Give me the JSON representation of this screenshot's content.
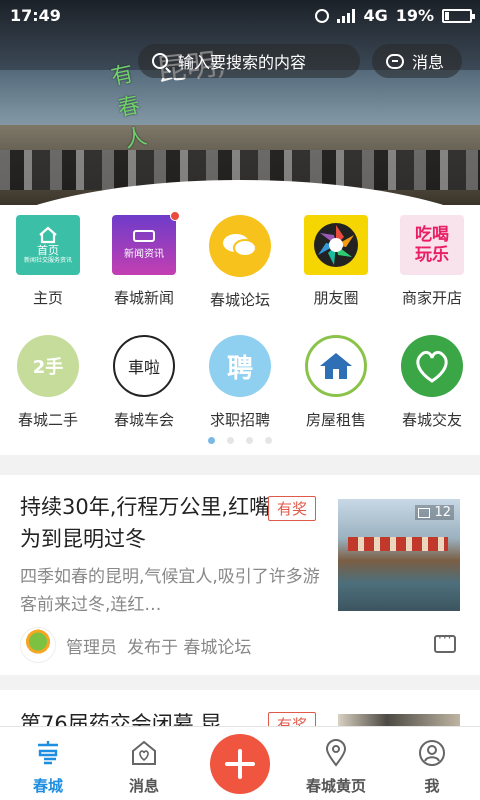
{
  "status": {
    "time": "17:49",
    "network": "4G",
    "battery": "19%"
  },
  "header": {
    "search_placeholder": "输入要搜索的内容",
    "messages_label": "消息",
    "banner_text_vertical": "有春人",
    "banner_text": "昆明,"
  },
  "grid": {
    "items": [
      {
        "label": "主页",
        "icon": "home-tile-icon",
        "tile_text": "首页",
        "tile_sub": "新闻社交服务资讯"
      },
      {
        "label": "春城新闻",
        "icon": "news-tile-icon",
        "tile_text": "新闻资讯"
      },
      {
        "label": "春城论坛",
        "icon": "forum-chat-icon"
      },
      {
        "label": "朋友圈",
        "icon": "aperture-icon"
      },
      {
        "label": "商家开店",
        "icon": "shop-tile-icon",
        "tile_text_1": "吃喝",
        "tile_text_2": "玩乐"
      },
      {
        "label": "春城二手",
        "icon": "secondhand-icon",
        "tile_text": "2手"
      },
      {
        "label": "春城车会",
        "icon": "car-club-icon",
        "tile_text": "車啦"
      },
      {
        "label": "求职招聘",
        "icon": "job-icon",
        "tile_text": "聘"
      },
      {
        "label": "房屋租售",
        "icon": "house-icon"
      },
      {
        "label": "春城交友",
        "icon": "dating-icon"
      }
    ],
    "page_count": 4,
    "active_page": 1
  },
  "feed": [
    {
      "title": "持续30年,行程万公里,红嘴鸥只为到昆明过冬",
      "tag": "有奖",
      "excerpt": "四季如春的昆明,气候宜人,吸引了许多游客前来过冬,连红…",
      "image_count": "12",
      "author": "管理员",
      "published_in": "发布于 春城论坛"
    },
    {
      "title": "第76届药交会闭幕 昆",
      "tag": "有奖"
    }
  ],
  "tabbar": {
    "tabs": [
      {
        "label": "春城",
        "icon": "home-city-icon",
        "active": true
      },
      {
        "label": "消息",
        "icon": "heart-house-icon",
        "active": false
      },
      {
        "label": "春城黄页",
        "icon": "location-pin-icon",
        "active": false
      },
      {
        "label": "我",
        "icon": "user-icon",
        "active": false
      }
    ],
    "center_action": "plus-icon"
  },
  "colors": {
    "accent": "#1e8ee0",
    "tag_red": "#e05a4a",
    "fab": "#f0563f"
  }
}
